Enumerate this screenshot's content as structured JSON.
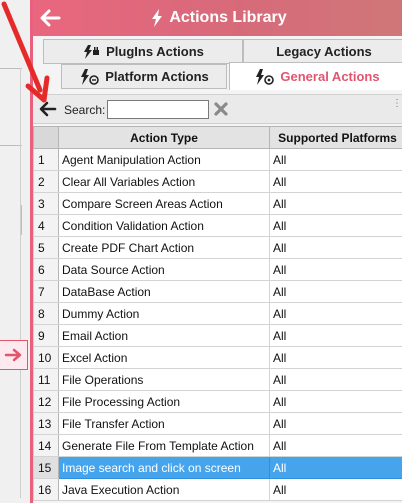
{
  "header": {
    "title": "Actions Library"
  },
  "tabs": [
    {
      "label": "PlugIns Actions",
      "icon": "plugin-icon"
    },
    {
      "label": "Legacy Actions"
    },
    {
      "label": "Platform Actions",
      "icon": "platform-icon"
    },
    {
      "label": "General Actions",
      "icon": "general-icon",
      "active": true
    }
  ],
  "search": {
    "label": "Search:",
    "value": ""
  },
  "table": {
    "columns": [
      "Action Type",
      "Supported Platforms"
    ],
    "rows": [
      {
        "num": "1",
        "type": "Agent Manipulation Action",
        "platforms": "All"
      },
      {
        "num": "2",
        "type": "Clear All Variables Action",
        "platforms": "All"
      },
      {
        "num": "3",
        "type": "Compare Screen Areas Action",
        "platforms": "All"
      },
      {
        "num": "4",
        "type": "Condition Validation Action",
        "platforms": "All"
      },
      {
        "num": "5",
        "type": "Create PDF Chart Action",
        "platforms": "All"
      },
      {
        "num": "6",
        "type": "Data Source Action",
        "platforms": "All"
      },
      {
        "num": "7",
        "type": "DataBase Action",
        "platforms": "All"
      },
      {
        "num": "8",
        "type": "Dummy Action",
        "platforms": "All"
      },
      {
        "num": "9",
        "type": "Email Action",
        "platforms": "All"
      },
      {
        "num": "10",
        "type": "Excel Action",
        "platforms": "All"
      },
      {
        "num": "11",
        "type": "File Operations",
        "platforms": "All"
      },
      {
        "num": "12",
        "type": "File Processing Action",
        "platforms": "All"
      },
      {
        "num": "13",
        "type": "File Transfer Action",
        "platforms": "All"
      },
      {
        "num": "14",
        "type": "Generate File From Template Action",
        "platforms": "All"
      },
      {
        "num": "15",
        "type": "Image search and click on screen",
        "platforms": "All",
        "selected": true
      },
      {
        "num": "16",
        "type": "Java Execution Action",
        "platforms": "All"
      }
    ]
  },
  "colors": {
    "header": "#e9677e",
    "accent": "#e05570",
    "selection": "#46a4ec"
  }
}
